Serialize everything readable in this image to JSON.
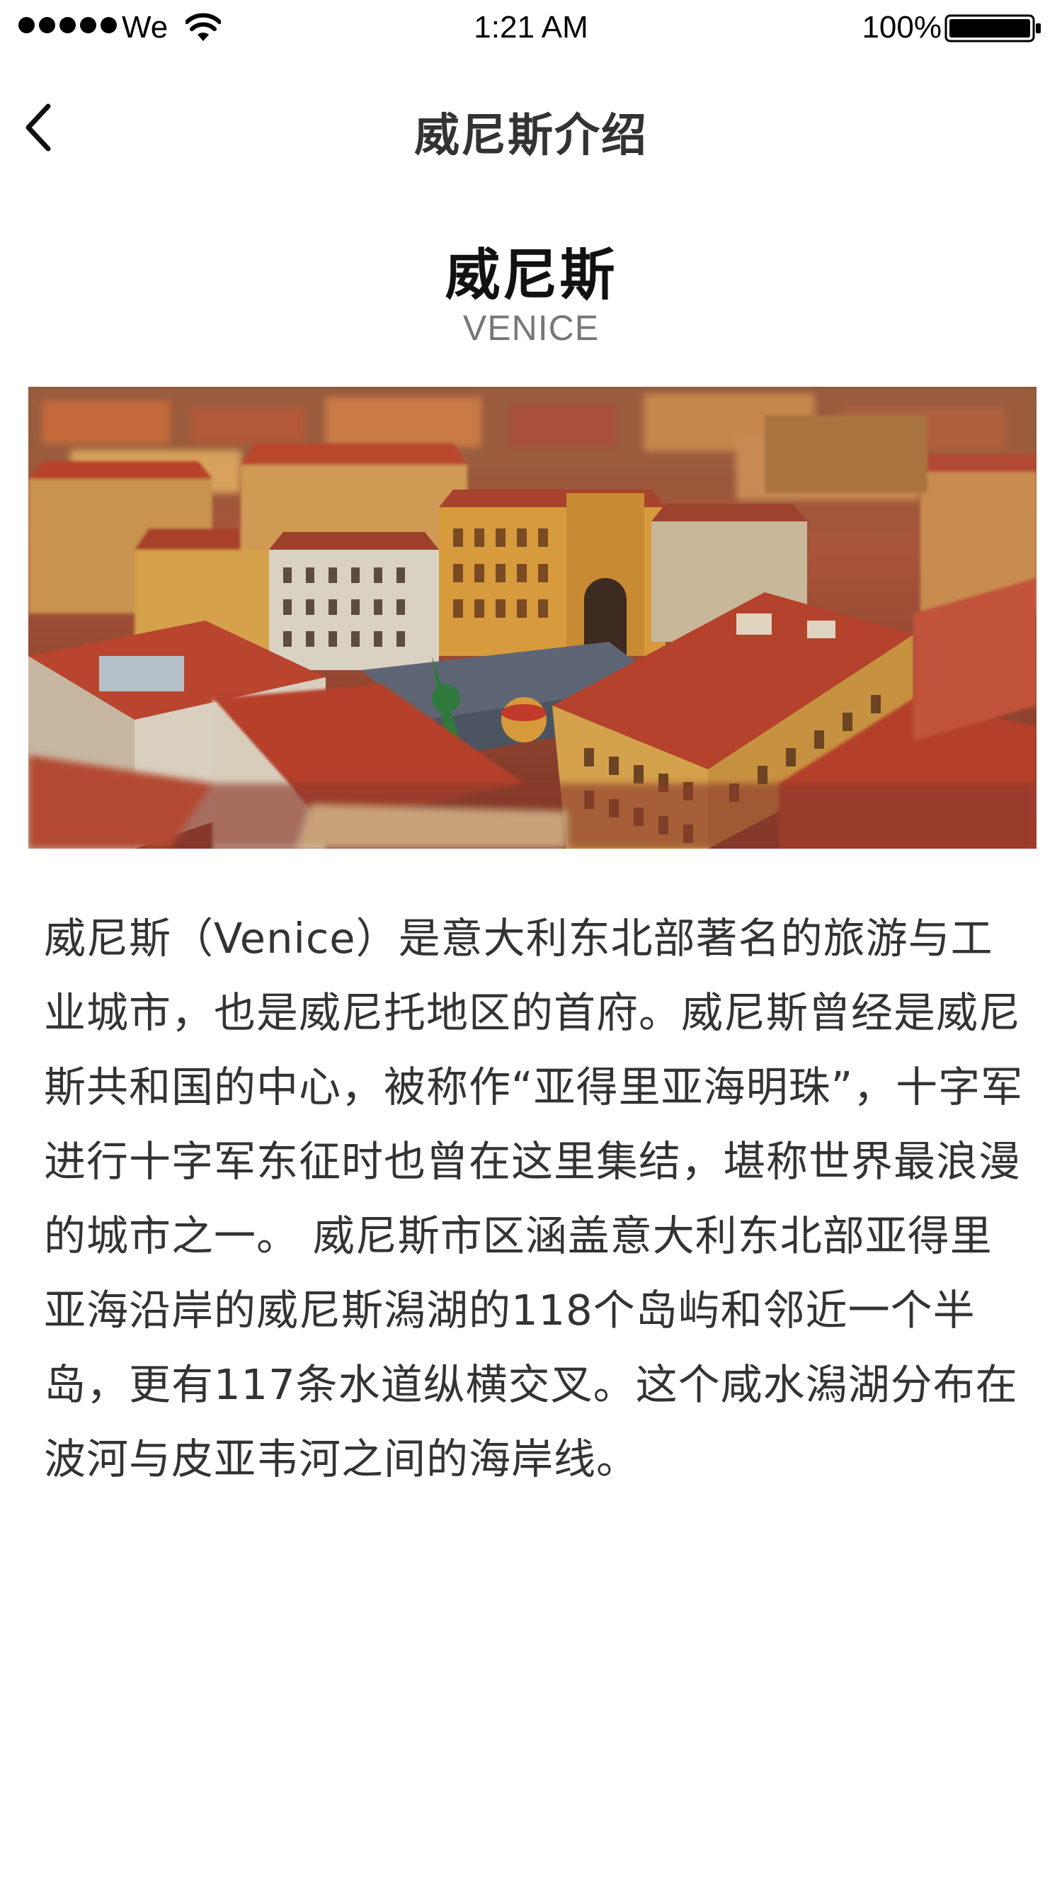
{
  "status_bar": {
    "carrier": "We",
    "time": "1:21 AM",
    "battery": "100%"
  },
  "nav": {
    "title": "威尼斯介绍",
    "back_icon": "chevron-left-icon"
  },
  "header": {
    "title": "威尼斯",
    "subtitle": "VENICE"
  },
  "hero_image": {
    "subject": "aerial-city-photo"
  },
  "description": "威尼斯（Venice）是意大利东北部著名的旅游与工业城市，也是威尼托地区的首府。威尼斯曾经是威尼斯共和国的中心，被称作“亚得里亚海明珠”，十字军进行十字军东征时也曾在这里集结，堪称世界最浪漫的城市之一。 威尼斯市区涵盖意大利东北部亚得里亚海沿岸的威尼斯潟湖的118个岛屿和邻近一个半岛，更有117条水道纵横交叉。这个咸水潟湖分布在波河与皮亚韦河之间的海岸线。",
  "colors": {
    "title": "#333333",
    "subtitle": "#777777",
    "body": "#333333",
    "roof": "#b8432c",
    "facade": "#d9a24a"
  }
}
